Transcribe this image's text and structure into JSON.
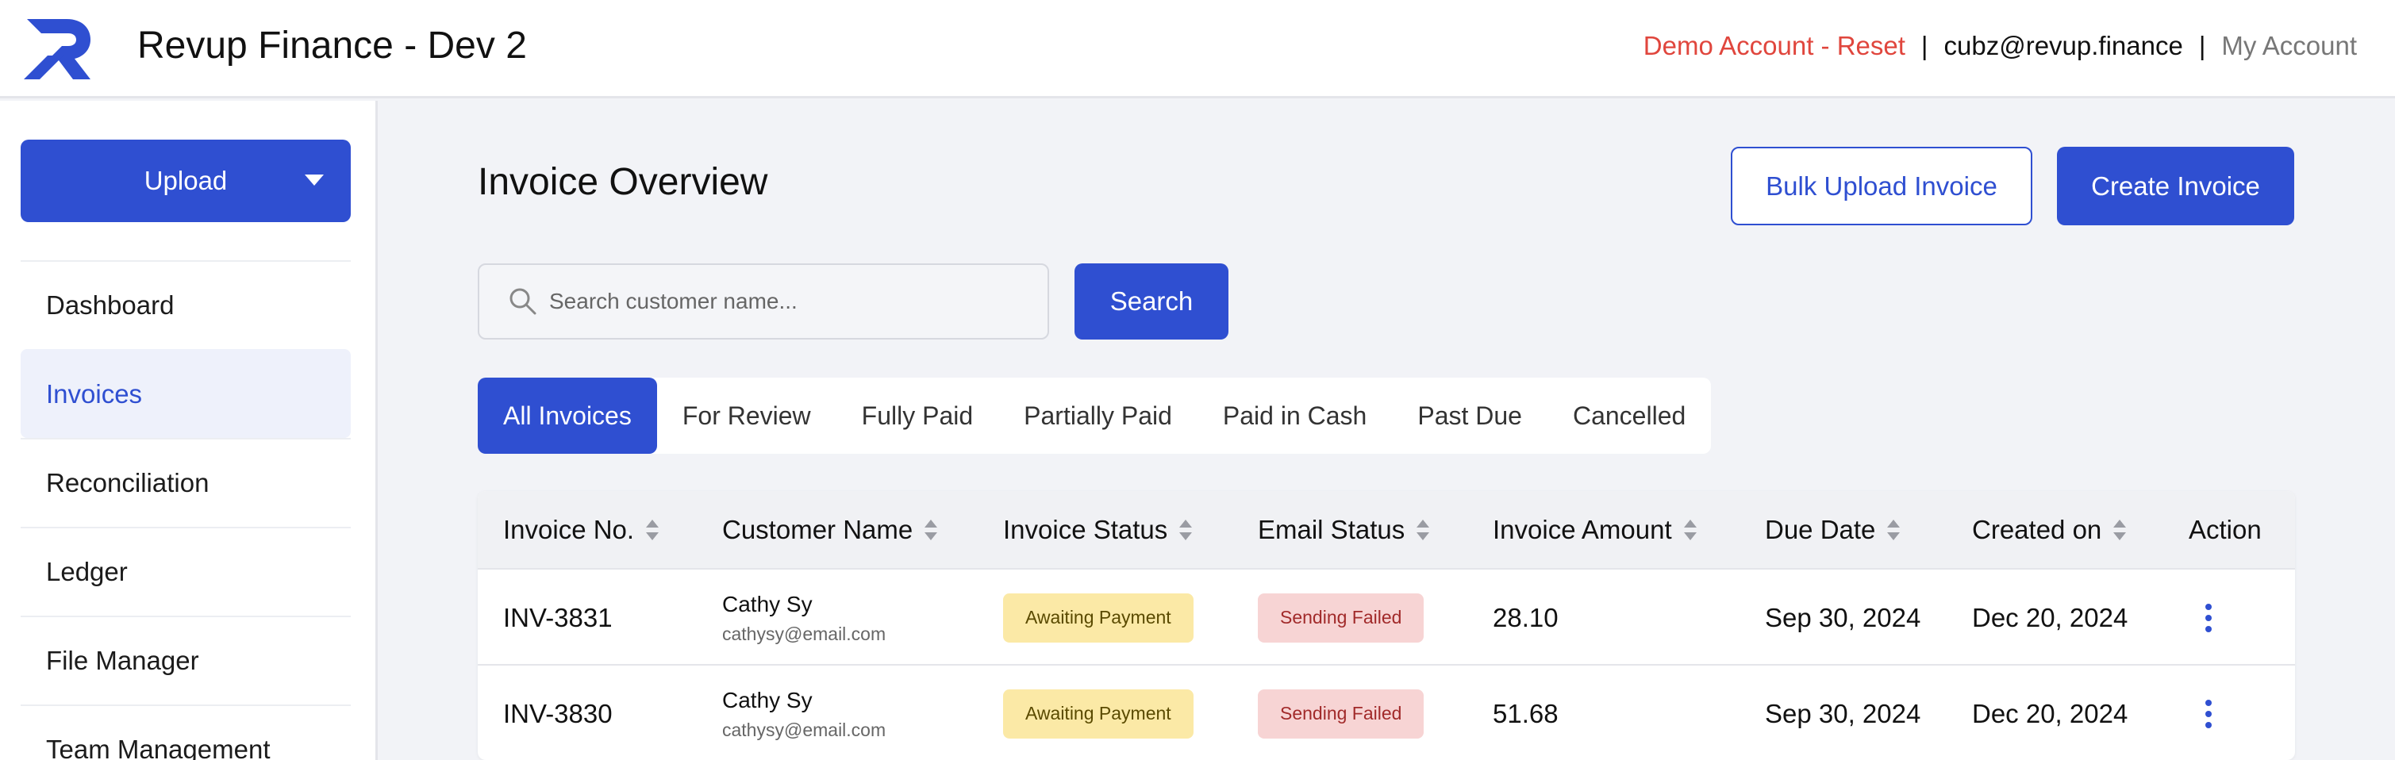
{
  "header": {
    "app_title": "Revup Finance - Dev 2",
    "demo_link": "Demo Account - Reset",
    "separator": "|",
    "email": "cubz@revup.finance",
    "my_account": "My Account"
  },
  "sidebar": {
    "upload_label": "Upload",
    "items": [
      {
        "label": "Dashboard"
      },
      {
        "label": "Invoices"
      },
      {
        "label": "Reconciliation"
      },
      {
        "label": "Ledger"
      },
      {
        "label": "File Manager"
      },
      {
        "label": "Team Management"
      }
    ],
    "active_item": "Invoices"
  },
  "main": {
    "title": "Invoice Overview",
    "bulk_upload_label": "Bulk Upload Invoice",
    "create_invoice_label": "Create Invoice",
    "search": {
      "placeholder": "Search customer name...",
      "value": "",
      "button_label": "Search"
    },
    "tabs": [
      {
        "label": "All Invoices"
      },
      {
        "label": "For Review"
      },
      {
        "label": "Fully Paid"
      },
      {
        "label": "Partially Paid"
      },
      {
        "label": "Paid in Cash"
      },
      {
        "label": "Past Due"
      },
      {
        "label": "Cancelled"
      }
    ],
    "active_tab": "All Invoices",
    "table": {
      "columns": [
        "Invoice No.",
        "Customer Name",
        "Invoice Status",
        "Email Status",
        "Invoice Amount",
        "Due Date",
        "Created on",
        "Action"
      ],
      "rows": [
        {
          "invoice_no": "INV-3831",
          "customer_name": "Cathy Sy",
          "customer_email": "cathysy@email.com",
          "invoice_status": "Awaiting Payment",
          "email_status": "Sending Failed",
          "amount": "28.10",
          "due_date": "Sep 30, 2024",
          "created_on": "Dec 20, 2024"
        },
        {
          "invoice_no": "INV-3830",
          "customer_name": "Cathy Sy",
          "customer_email": "cathysy@email.com",
          "invoice_status": "Awaiting Payment",
          "email_status": "Sending Failed",
          "amount": "51.68",
          "due_date": "Sep 30, 2024",
          "created_on": "Dec 20, 2024"
        }
      ]
    }
  },
  "colors": {
    "accent": "#2f4fd1",
    "demo_link": "#e0463d",
    "awaiting_badge": "#fbe9a6",
    "failed_badge": "#f7d4d4"
  },
  "icons": {
    "logo": "revup-logo",
    "upload_caret": "caret-down-icon",
    "search": "search-icon",
    "sort": "sort-icon",
    "action": "more-vertical-icon"
  }
}
